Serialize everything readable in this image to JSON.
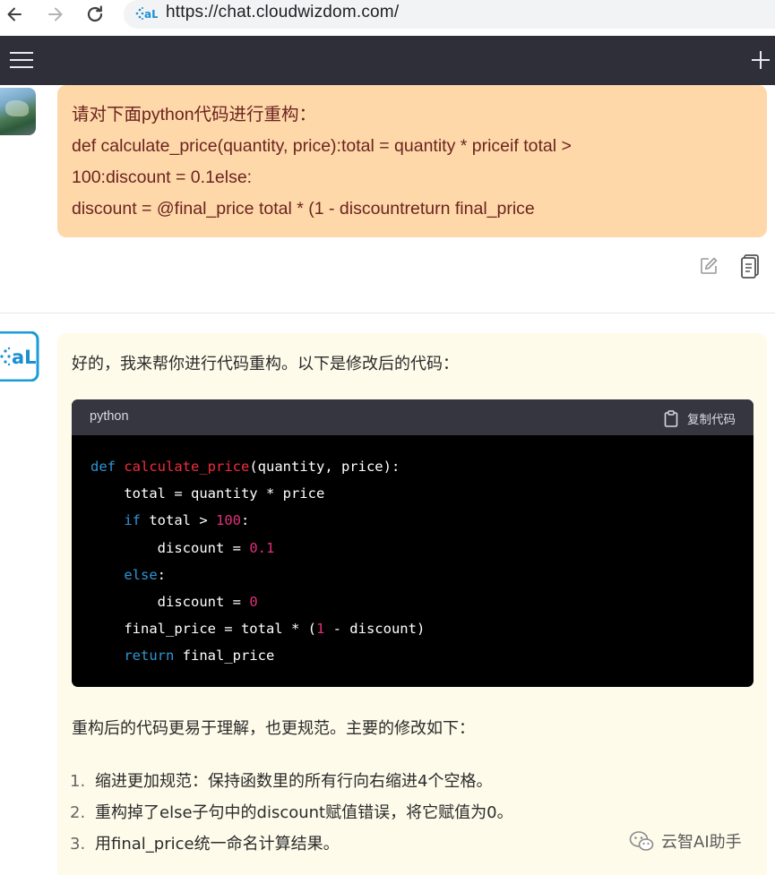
{
  "browser": {
    "url": "https://chat.cloudwizdom.com/",
    "back_icon": "arrow-left-icon",
    "forward_icon": "arrow-right-icon",
    "reload_icon": "reload-icon"
  },
  "app_header": {
    "menu_icon": "hamburger-menu-icon",
    "new_chat_icon": "plus-icon"
  },
  "user_message": {
    "lines": [
      "请对下面python代码进行重构：",
      "def calculate_price(quantity, price):total = quantity * priceif total >",
      "100:discount = 0.1else:",
      "discount = @final_price  total * (1 - discountreturn final_price"
    ],
    "actions": [
      "edit-icon",
      "copy-icon"
    ]
  },
  "assistant_message": {
    "intro": "好的，我来帮你进行代码重构。以下是修改后的代码：",
    "code_block": {
      "language": "python",
      "copy_label": "复制代码",
      "lines": [
        [
          {
            "t": "kw",
            "v": "def"
          },
          {
            "t": "plain",
            "v": " "
          },
          {
            "t": "fn",
            "v": "calculate_price"
          },
          {
            "t": "plain",
            "v": "(quantity, price):"
          }
        ],
        [
          {
            "t": "plain",
            "v": "    total = quantity * price"
          }
        ],
        [
          {
            "t": "plain",
            "v": "    "
          },
          {
            "t": "kw",
            "v": "if"
          },
          {
            "t": "plain",
            "v": " total > "
          },
          {
            "t": "num",
            "v": "100"
          },
          {
            "t": "plain",
            "v": ":"
          }
        ],
        [
          {
            "t": "plain",
            "v": "        discount = "
          },
          {
            "t": "num",
            "v": "0.1"
          }
        ],
        [
          {
            "t": "plain",
            "v": "    "
          },
          {
            "t": "kw",
            "v": "else"
          },
          {
            "t": "plain",
            "v": ":"
          }
        ],
        [
          {
            "t": "plain",
            "v": "        discount = "
          },
          {
            "t": "num",
            "v": "0"
          }
        ],
        [
          {
            "t": "plain",
            "v": "    final_price = total * ("
          },
          {
            "t": "num",
            "v": "1"
          },
          {
            "t": "plain",
            "v": " - discount)"
          }
        ],
        [
          {
            "t": "plain",
            "v": "    "
          },
          {
            "t": "kw",
            "v": "return"
          },
          {
            "t": "plain",
            "v": " final_price"
          }
        ]
      ]
    },
    "summary": "重构后的代码更易于理解，也更规范。主要的修改如下：",
    "list": [
      {
        "num": "1.",
        "text": "缩进更加规范：保持函数里的所有行向右缩进4个空格。"
      },
      {
        "num": "2.",
        "text": "重构掉了else子句中的discount赋值错误，将它赋值为0。"
      },
      {
        "num": "3.",
        "text": "用final_price统一命名计算结果。"
      }
    ]
  },
  "watermark": {
    "text": "云智AI助手",
    "icon": "wechat-icon"
  },
  "colors": {
    "header_bg": "#2f2f3a",
    "user_bubble": "#fed8a9",
    "user_text": "#6b2420",
    "ai_bubble": "#fefbea",
    "code_bg": "#000000",
    "code_header": "#363641",
    "keyword": "#2e95d3",
    "function": "#f22c3d",
    "number": "#df3079"
  }
}
